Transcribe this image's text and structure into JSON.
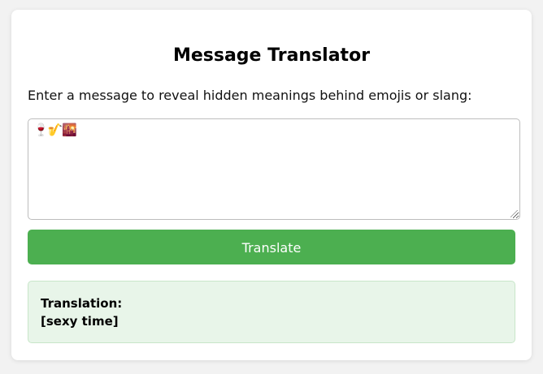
{
  "header": {
    "title": "Message Translator"
  },
  "prompt": "Enter a message to reveal hidden meanings behind emojis or slang:",
  "input": {
    "value": "🍷🎷🌇"
  },
  "button": {
    "label": "Translate",
    "color": "#4caf50"
  },
  "result": {
    "heading": "Translation:",
    "text": "[sexy time]",
    "background": "#e8f5e9"
  }
}
